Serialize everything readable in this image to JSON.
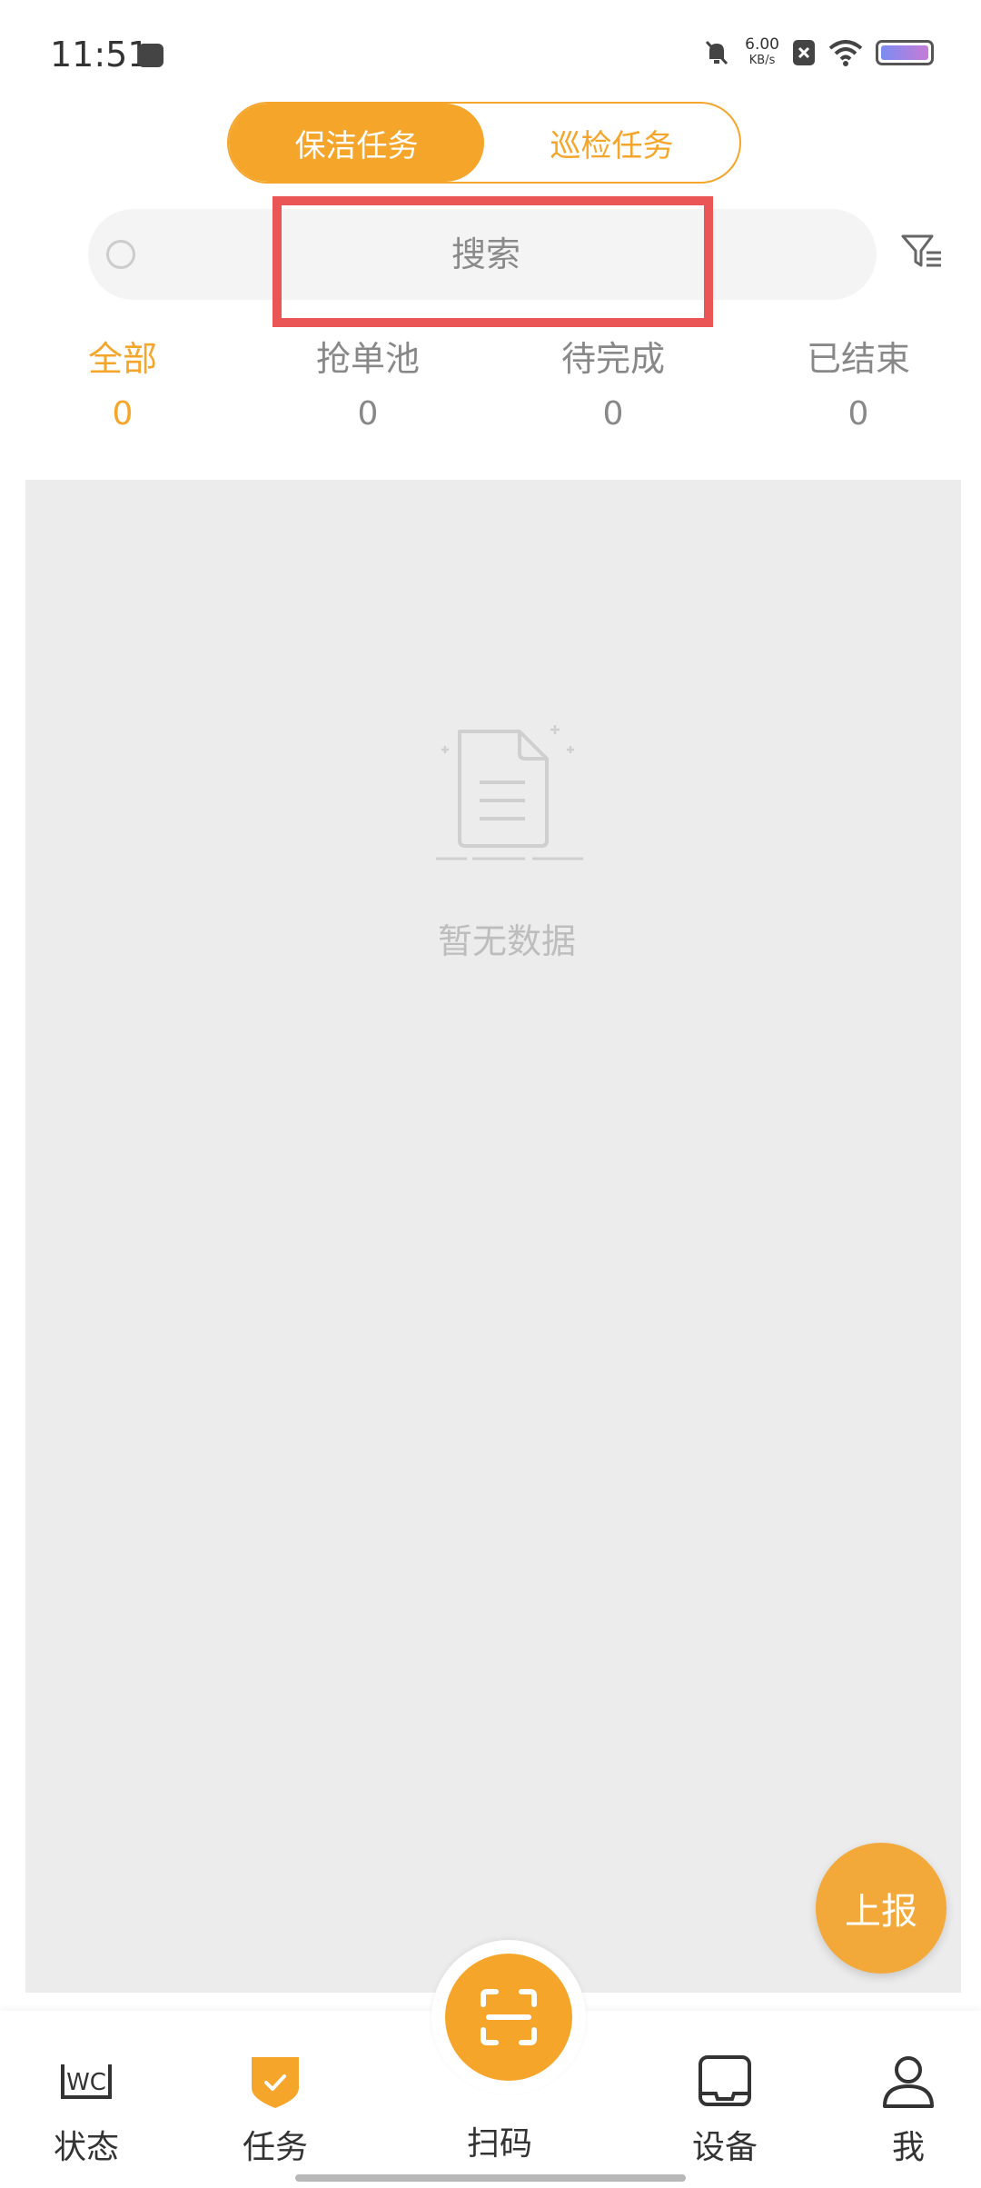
{
  "status_bar": {
    "time": "11:51",
    "net_speed_value": "6.00",
    "net_speed_unit": "KB/s"
  },
  "segment": {
    "items": [
      {
        "label": "保洁任务",
        "active": true
      },
      {
        "label": "巡检任务",
        "active": false
      }
    ]
  },
  "search": {
    "placeholder": "搜索",
    "value": ""
  },
  "tabs": [
    {
      "label": "全部",
      "count": "0"
    },
    {
      "label": "抢单池",
      "count": "0"
    },
    {
      "label": "待完成",
      "count": "0"
    },
    {
      "label": "已结束",
      "count": "0"
    }
  ],
  "empty": {
    "text": "暂无数据"
  },
  "report_button": {
    "label": "上报"
  },
  "nav": {
    "status": "状态",
    "tasks": "任务",
    "scan": "扫码",
    "devices": "设备",
    "me": "我"
  },
  "icons": {
    "status": "wc-icon",
    "tasks": "shield-check-icon",
    "scan": "scan-icon",
    "devices": "device-icon",
    "me": "user-icon",
    "filter": "filter-icon",
    "search": "search-icon"
  },
  "colors": {
    "accent": "#f5a52a",
    "highlight": "#ea5656",
    "content_bg": "#ececec"
  }
}
